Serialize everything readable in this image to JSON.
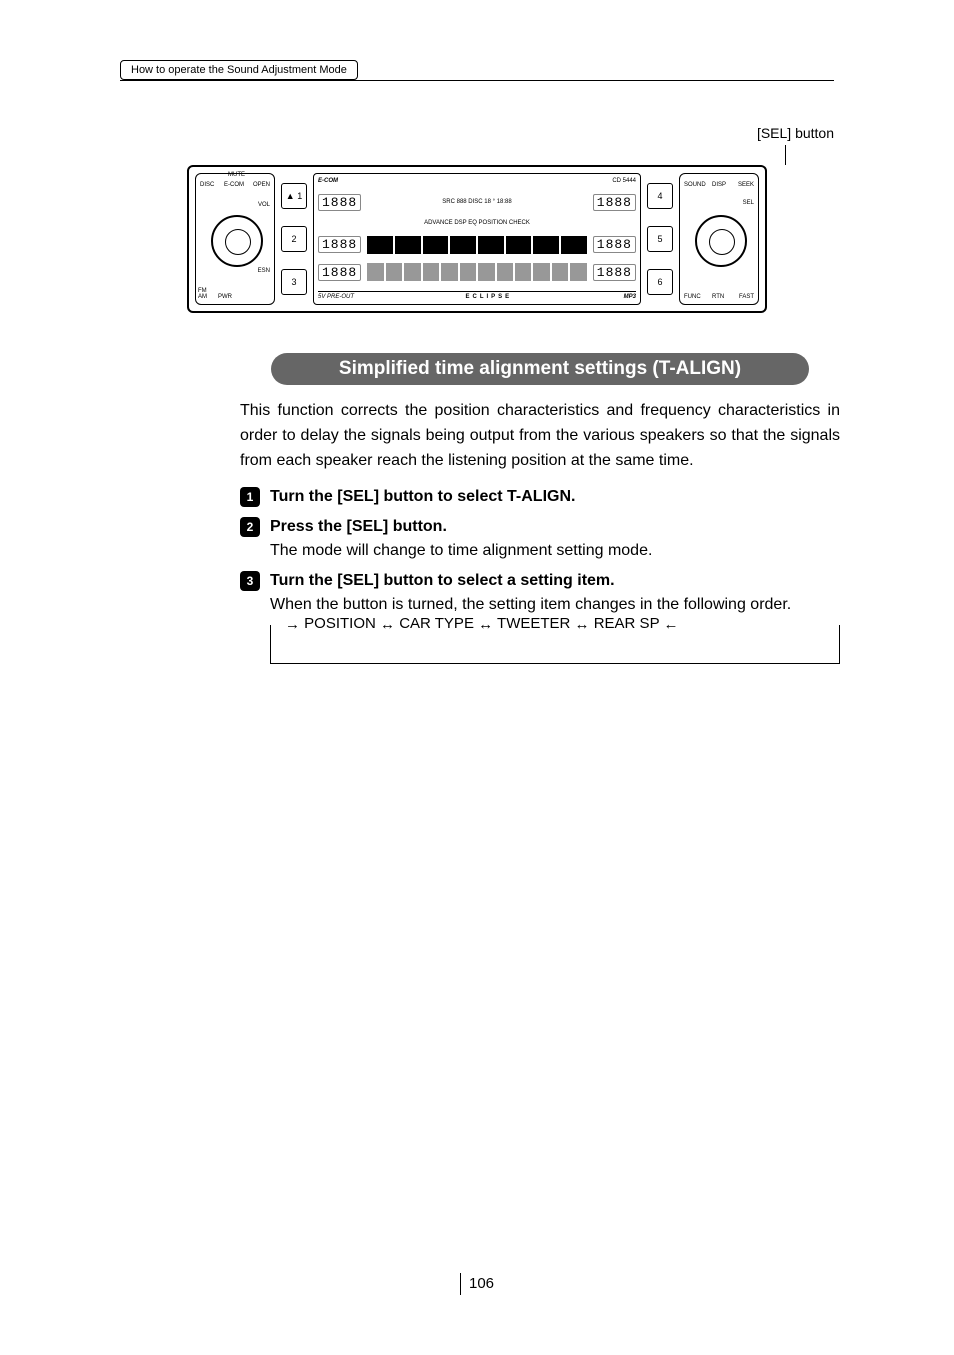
{
  "header": {
    "breadcrumb": "How to operate the Sound Adjustment Mode"
  },
  "callout": {
    "sel_button": "[SEL] button"
  },
  "device": {
    "left_knob_labels": {
      "mute": "MUTE",
      "disc": "DISC",
      "ecom": "E-COM",
      "open": "OPEN",
      "vol": "VOL",
      "esn": "ESN",
      "fm_am": "FM\nAM",
      "pwr": "PWR"
    },
    "left_col": [
      "▲ 1",
      "2",
      "3"
    ],
    "right_col": [
      "4",
      "5",
      "6"
    ],
    "screen": {
      "brand_top": "E-COM",
      "model": "CD 5444",
      "seg_left": [
        "1888",
        "1888",
        "1888"
      ],
      "seg_right": [
        "1888",
        "1888",
        "1888"
      ],
      "top_line": "SRC 888 DISC 18 ° 18:88",
      "tags": "ADVANCE  DSP  EQ  POSITION  CHECK",
      "preout": "5V PRE-OUT",
      "mp3": "MP3",
      "brand_bottom": "ECLIPSE"
    },
    "right_knob_labels": {
      "sound": "SOUND",
      "disp": "DISP",
      "seek_up": "SEEK",
      "sel": "SEL",
      "func": "FUNC",
      "rtn": "RTN",
      "fast": "FAST"
    }
  },
  "section": {
    "title": "Simplified time alignment settings (T-ALIGN)",
    "intro": "This function corrects the position characteristics and frequency characteristics in order to delay the signals being output from the various speakers so that the signals from each speaker reach the listening position at the same time.",
    "steps": [
      {
        "n": "1",
        "bold": "Turn the [SEL] button to select T-ALIGN."
      },
      {
        "n": "2",
        "bold": "Press the [SEL] button.",
        "body": "The mode will change to time alignment setting mode."
      },
      {
        "n": "3",
        "bold": "Turn the [SEL] button to select a setting item.",
        "body": "When the button is turned, the setting item changes in the following order."
      }
    ],
    "flow": {
      "a": "POSITION",
      "b": "CAR TYPE",
      "c": "TWEETER",
      "d": "REAR SP"
    }
  },
  "page_number": "106"
}
